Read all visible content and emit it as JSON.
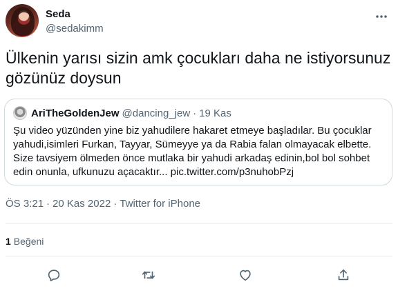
{
  "tweet": {
    "author": {
      "name": "Seda",
      "handle": "@sedakimm"
    },
    "text": "Ülkenin yarısı sizin amk çocukları daha ne istiyorsunuz gözünüz doysun",
    "quoted": {
      "name": "AriTheGoldenJew",
      "handle": "@dancing_jew",
      "separator": "·",
      "date": "19 Kas",
      "text": "Şu video yüzünden yine biz yahudilere hakaret etmeye başladılar. Bu çocuklar yahudi,isimleri Furkan, Tayyar, Sümeyye ya da Rabia falan olmayacak elbette. Size tavsiyem ölmeden önce mutlaka bir yahudi arkadaş edinin,bol bol sohbet edin onunla, ufkunuzu açacaktır... pic.twitter.com/p3nuhobPzj"
    },
    "time": "ÖS 3:21",
    "date": "20 Kas 2022",
    "separator": "·",
    "source": "Twitter for iPhone",
    "likes_count": "1",
    "likes_label": "Beğeni"
  },
  "icons": {
    "more": "more-dots-icon",
    "reply": "reply-icon",
    "retweet": "retweet-icon",
    "like": "like-icon",
    "share": "share-icon"
  },
  "colors": {
    "text": "#0f1419",
    "secondary": "#536471",
    "border": "#cfd9de",
    "divider": "#eff3f4"
  }
}
